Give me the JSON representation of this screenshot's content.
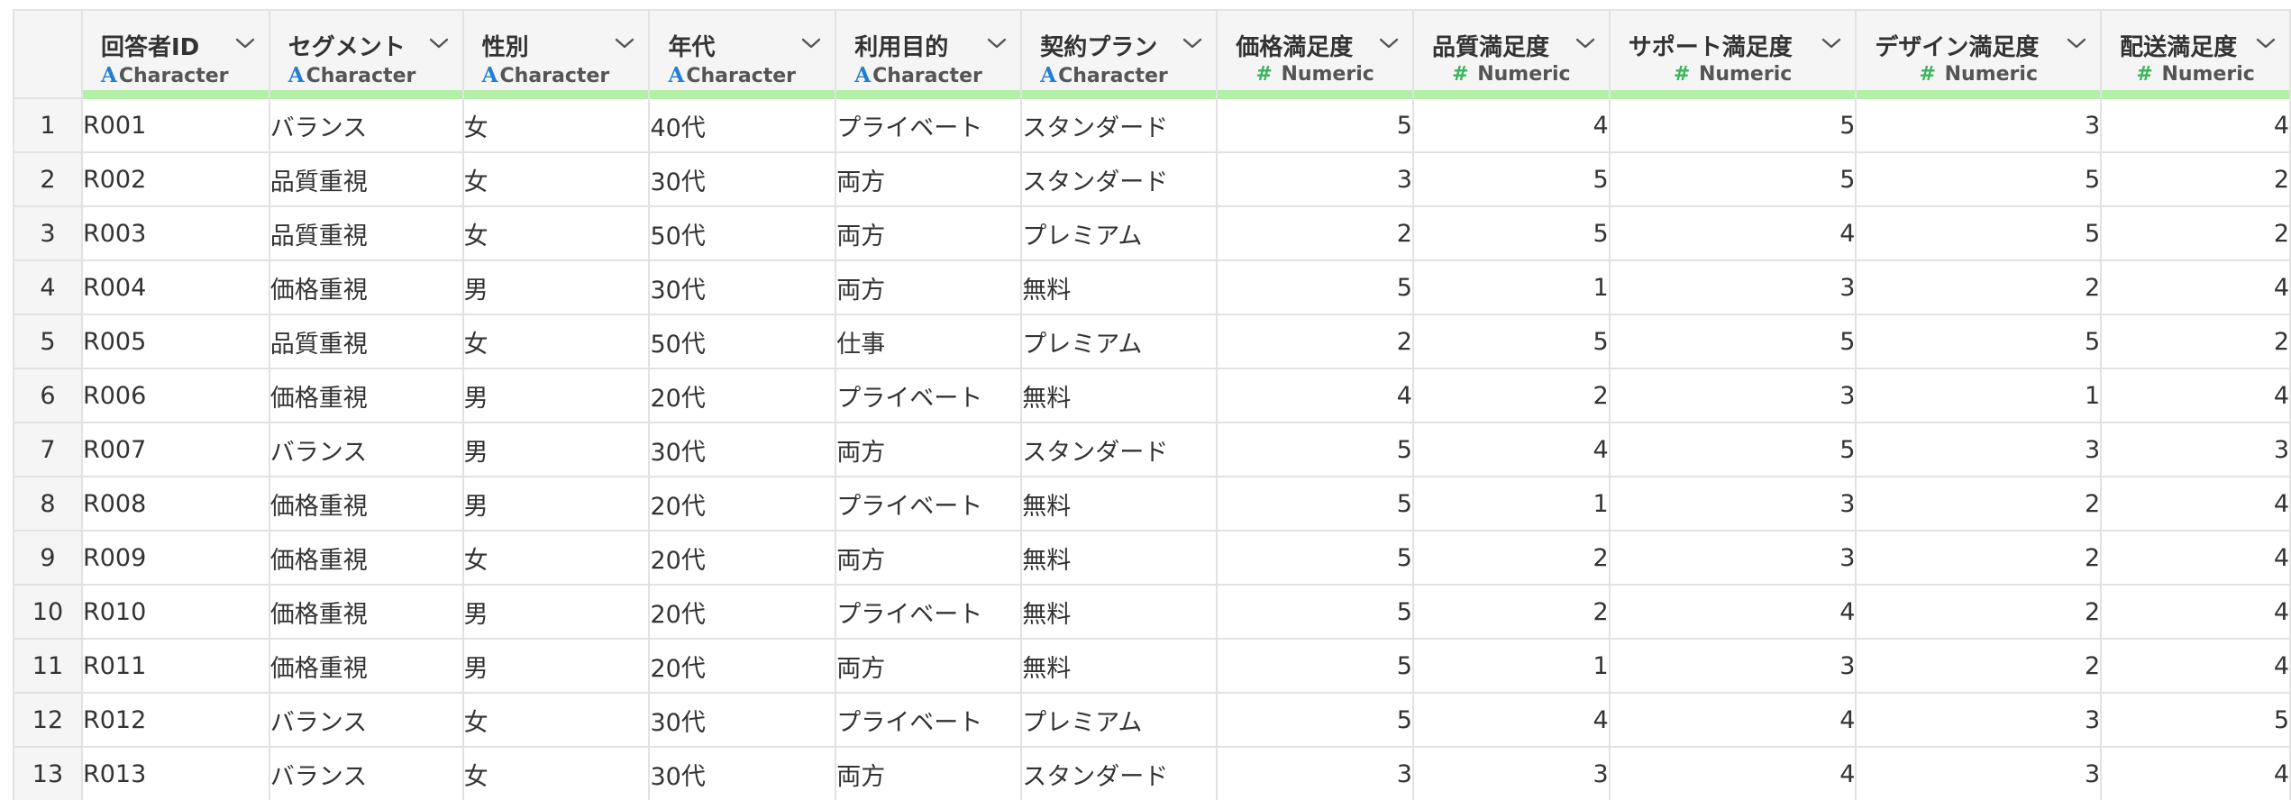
{
  "columns": [
    {
      "name": "回答者ID",
      "type": "Character",
      "kind": "char"
    },
    {
      "name": "セグメント",
      "type": "Character",
      "kind": "char"
    },
    {
      "name": "性別",
      "type": "Character",
      "kind": "char"
    },
    {
      "name": "年代",
      "type": "Character",
      "kind": "char"
    },
    {
      "name": "利用目的",
      "type": "Character",
      "kind": "char"
    },
    {
      "name": "契約プラン",
      "type": "Character",
      "kind": "char"
    },
    {
      "name": "価格満足度",
      "type": "Numeric",
      "kind": "num"
    },
    {
      "name": "品質満足度",
      "type": "Numeric",
      "kind": "num"
    },
    {
      "name": "サポート満足度",
      "type": "Numeric",
      "kind": "num"
    },
    {
      "name": "デザイン満足度",
      "type": "Numeric",
      "kind": "num"
    },
    {
      "name": "配送満足度",
      "type": "Numeric",
      "kind": "num"
    }
  ],
  "icons": {
    "character": "A",
    "numeric": "#",
    "chevron": "chevron-down-icon"
  },
  "colors": {
    "character_icon": "#1f7fd6",
    "numeric_icon": "#3cb45a",
    "header_accent": "#b4f0a8"
  },
  "rows": [
    {
      "n": "1",
      "cells": [
        "R001",
        "バランス",
        "女",
        "40代",
        "プライベート",
        "スタンダード",
        "5",
        "4",
        "5",
        "3",
        "4"
      ]
    },
    {
      "n": "2",
      "cells": [
        "R002",
        "品質重視",
        "女",
        "30代",
        "両方",
        "スタンダード",
        "3",
        "5",
        "5",
        "5",
        "2"
      ]
    },
    {
      "n": "3",
      "cells": [
        "R003",
        "品質重視",
        "女",
        "50代",
        "両方",
        "プレミアム",
        "2",
        "5",
        "4",
        "5",
        "2"
      ]
    },
    {
      "n": "4",
      "cells": [
        "R004",
        "価格重視",
        "男",
        "30代",
        "両方",
        "無料",
        "5",
        "1",
        "3",
        "2",
        "4"
      ]
    },
    {
      "n": "5",
      "cells": [
        "R005",
        "品質重視",
        "女",
        "50代",
        "仕事",
        "プレミアム",
        "2",
        "5",
        "5",
        "5",
        "2"
      ]
    },
    {
      "n": "6",
      "cells": [
        "R006",
        "価格重視",
        "男",
        "20代",
        "プライベート",
        "無料",
        "4",
        "2",
        "3",
        "1",
        "4"
      ]
    },
    {
      "n": "7",
      "cells": [
        "R007",
        "バランス",
        "男",
        "30代",
        "両方",
        "スタンダード",
        "5",
        "4",
        "5",
        "3",
        "3"
      ]
    },
    {
      "n": "8",
      "cells": [
        "R008",
        "価格重視",
        "男",
        "20代",
        "プライベート",
        "無料",
        "5",
        "1",
        "3",
        "2",
        "4"
      ]
    },
    {
      "n": "9",
      "cells": [
        "R009",
        "価格重視",
        "女",
        "20代",
        "両方",
        "無料",
        "5",
        "2",
        "3",
        "2",
        "4"
      ]
    },
    {
      "n": "10",
      "cells": [
        "R010",
        "価格重視",
        "男",
        "20代",
        "プライベート",
        "無料",
        "5",
        "2",
        "4",
        "2",
        "4"
      ]
    },
    {
      "n": "11",
      "cells": [
        "R011",
        "価格重視",
        "男",
        "20代",
        "両方",
        "無料",
        "5",
        "1",
        "3",
        "2",
        "4"
      ]
    },
    {
      "n": "12",
      "cells": [
        "R012",
        "バランス",
        "女",
        "30代",
        "プライベート",
        "プレミアム",
        "5",
        "4",
        "4",
        "3",
        "5"
      ]
    },
    {
      "n": "13",
      "cells": [
        "R013",
        "バランス",
        "女",
        "30代",
        "両方",
        "スタンダード",
        "3",
        "3",
        "4",
        "3",
        "4"
      ]
    }
  ]
}
